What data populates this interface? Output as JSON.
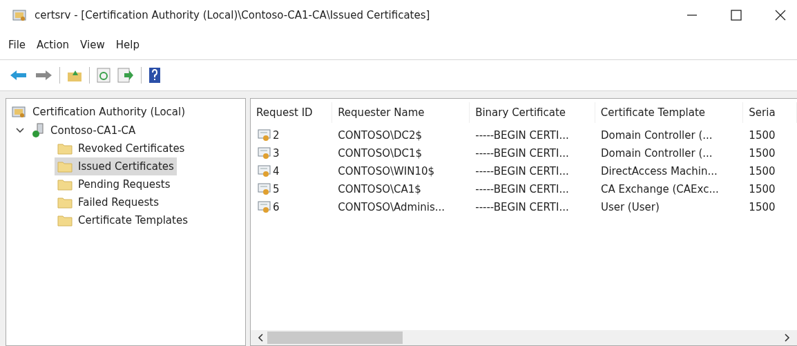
{
  "window": {
    "title": "certsrv - [Certification Authority (Local)\\Contoso-CA1-CA\\Issued Certificates]"
  },
  "menu": [
    "File",
    "Action",
    "View",
    "Help"
  ],
  "tree": [
    {
      "label": "Certification Authority (Local)",
      "kind": "root",
      "selected": false,
      "children": [
        {
          "label": "Contoso-CA1-CA",
          "kind": "server",
          "selected": false,
          "expanded": true,
          "children": [
            {
              "label": "Revoked Certificates",
              "kind": "folder",
              "selected": false
            },
            {
              "label": "Issued Certificates",
              "kind": "folder",
              "selected": true
            },
            {
              "label": "Pending Requests",
              "kind": "folder",
              "selected": false
            },
            {
              "label": "Failed Requests",
              "kind": "folder",
              "selected": false
            },
            {
              "label": "Certificate Templates",
              "kind": "folder",
              "selected": false
            }
          ]
        }
      ]
    }
  ],
  "table": {
    "columns": [
      "Request ID",
      "Requester Name",
      "Binary Certificate",
      "Certificate Template",
      "Seria"
    ],
    "rows": [
      [
        "2",
        "CONTOSO\\DC2$",
        "-----BEGIN CERTI...",
        "Domain Controller (...",
        "1500"
      ],
      [
        "3",
        "CONTOSO\\DC1$",
        "-----BEGIN CERTI...",
        "Domain Controller (...",
        "1500"
      ],
      [
        "4",
        "CONTOSO\\WIN10$",
        "-----BEGIN CERTI...",
        "DirectAccess Machin...",
        "1500"
      ],
      [
        "5",
        "CONTOSO\\CA1$",
        "-----BEGIN CERTI...",
        "CA Exchange (CAExc...",
        "1500"
      ],
      [
        "6",
        "CONTOSO\\Adminis...",
        "-----BEGIN CERTI...",
        "User (User)",
        "1500"
      ]
    ]
  }
}
